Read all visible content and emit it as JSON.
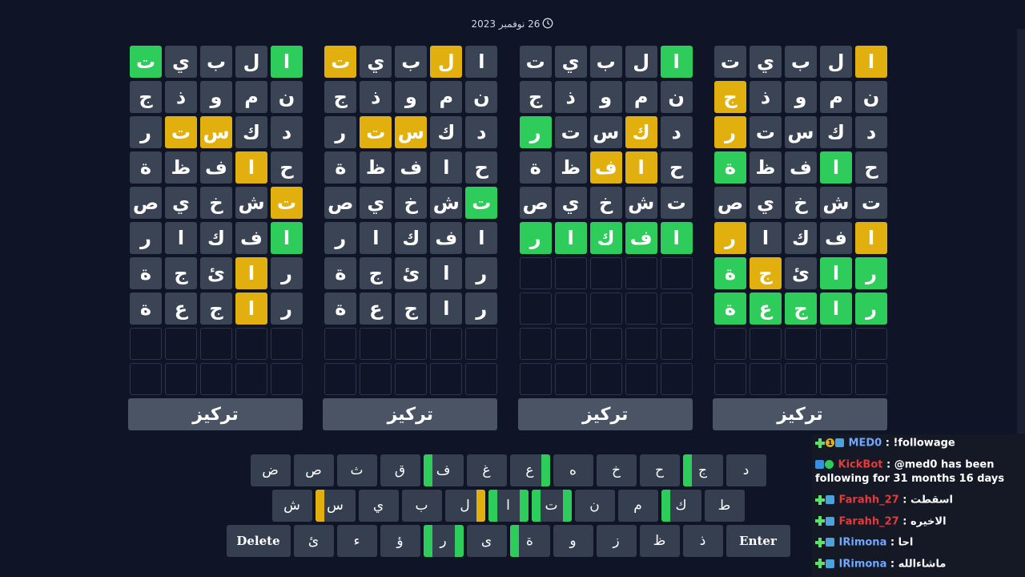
{
  "date": "26 نوفمبر 2023",
  "focus_label": "تركيز",
  "boards": [
    {
      "rows": [
        [
          [
            "ا",
            "p"
          ],
          [
            "ل",
            ""
          ],
          [
            "ب",
            ""
          ],
          [
            "ي",
            ""
          ],
          [
            "ت",
            ""
          ]
        ],
        [
          [
            "ن",
            ""
          ],
          [
            "م",
            ""
          ],
          [
            "و",
            ""
          ],
          [
            "ذ",
            ""
          ],
          [
            "ج",
            "p"
          ]
        ],
        [
          [
            "د",
            ""
          ],
          [
            "ك",
            ""
          ],
          [
            "س",
            ""
          ],
          [
            "ت",
            ""
          ],
          [
            "ر",
            "p"
          ]
        ],
        [
          [
            "ح",
            ""
          ],
          [
            "ا",
            "c"
          ],
          [
            "ف",
            ""
          ],
          [
            "ظ",
            ""
          ],
          [
            "ة",
            "c"
          ]
        ],
        [
          [
            "ت",
            ""
          ],
          [
            "ش",
            ""
          ],
          [
            "خ",
            ""
          ],
          [
            "ي",
            ""
          ],
          [
            "ص",
            ""
          ]
        ],
        [
          [
            "ا",
            "p"
          ],
          [
            "ف",
            ""
          ],
          [
            "ك",
            ""
          ],
          [
            "ا",
            ""
          ],
          [
            "ر",
            "p"
          ]
        ],
        [
          [
            "ر",
            "c"
          ],
          [
            "ا",
            "c"
          ],
          [
            "ئ",
            ""
          ],
          [
            "ج",
            "p"
          ],
          [
            "ة",
            "c"
          ]
        ],
        [
          [
            "ر",
            "c"
          ],
          [
            "ا",
            "c"
          ],
          [
            "ج",
            "c"
          ],
          [
            "ع",
            "c"
          ],
          [
            "ة",
            "c"
          ]
        ],
        [
          [
            "",
            "e"
          ],
          [
            "",
            "e"
          ],
          [
            "",
            "e"
          ],
          [
            "",
            "e"
          ],
          [
            "",
            "e"
          ]
        ],
        [
          [
            "",
            "e"
          ],
          [
            "",
            "e"
          ],
          [
            "",
            "e"
          ],
          [
            "",
            "e"
          ],
          [
            "",
            "e"
          ]
        ]
      ]
    },
    {
      "rows": [
        [
          [
            "ا",
            "c"
          ],
          [
            "ل",
            ""
          ],
          [
            "ب",
            ""
          ],
          [
            "ي",
            ""
          ],
          [
            "ت",
            ""
          ]
        ],
        [
          [
            "ن",
            ""
          ],
          [
            "م",
            ""
          ],
          [
            "و",
            ""
          ],
          [
            "ذ",
            ""
          ],
          [
            "ج",
            ""
          ]
        ],
        [
          [
            "د",
            ""
          ],
          [
            "ك",
            "p"
          ],
          [
            "س",
            ""
          ],
          [
            "ت",
            ""
          ],
          [
            "ر",
            "c"
          ]
        ],
        [
          [
            "ح",
            ""
          ],
          [
            "ا",
            "p"
          ],
          [
            "ف",
            "p"
          ],
          [
            "ظ",
            ""
          ],
          [
            "ة",
            ""
          ]
        ],
        [
          [
            "ت",
            ""
          ],
          [
            "ش",
            ""
          ],
          [
            "خ",
            ""
          ],
          [
            "ي",
            ""
          ],
          [
            "ص",
            ""
          ]
        ],
        [
          [
            "ا",
            "c"
          ],
          [
            "ف",
            "c"
          ],
          [
            "ك",
            "c"
          ],
          [
            "ا",
            "c"
          ],
          [
            "ر",
            "c"
          ]
        ],
        [
          [
            "",
            "e"
          ],
          [
            "",
            "e"
          ],
          [
            "",
            "e"
          ],
          [
            "",
            "e"
          ],
          [
            "",
            "e"
          ]
        ],
        [
          [
            "",
            "e"
          ],
          [
            "",
            "e"
          ],
          [
            "",
            "e"
          ],
          [
            "",
            "e"
          ],
          [
            "",
            "e"
          ]
        ],
        [
          [
            "",
            "e"
          ],
          [
            "",
            "e"
          ],
          [
            "",
            "e"
          ],
          [
            "",
            "e"
          ],
          [
            "",
            "e"
          ]
        ],
        [
          [
            "",
            "e"
          ],
          [
            "",
            "e"
          ],
          [
            "",
            "e"
          ],
          [
            "",
            "e"
          ],
          [
            "",
            "e"
          ]
        ]
      ]
    },
    {
      "rows": [
        [
          [
            "ا",
            ""
          ],
          [
            "ل",
            "p"
          ],
          [
            "ب",
            ""
          ],
          [
            "ي",
            ""
          ],
          [
            "ت",
            "p"
          ]
        ],
        [
          [
            "ن",
            ""
          ],
          [
            "م",
            ""
          ],
          [
            "و",
            ""
          ],
          [
            "ذ",
            ""
          ],
          [
            "ج",
            ""
          ]
        ],
        [
          [
            "د",
            ""
          ],
          [
            "ك",
            ""
          ],
          [
            "س",
            "p"
          ],
          [
            "ت",
            "p"
          ],
          [
            "ر",
            ""
          ]
        ],
        [
          [
            "ح",
            ""
          ],
          [
            "ا",
            ""
          ],
          [
            "ف",
            ""
          ],
          [
            "ظ",
            ""
          ],
          [
            "ة",
            ""
          ]
        ],
        [
          [
            "ت",
            "c"
          ],
          [
            "ش",
            ""
          ],
          [
            "خ",
            ""
          ],
          [
            "ي",
            ""
          ],
          [
            "ص",
            ""
          ]
        ],
        [
          [
            "ا",
            ""
          ],
          [
            "ف",
            ""
          ],
          [
            "ك",
            ""
          ],
          [
            "ا",
            ""
          ],
          [
            "ر",
            ""
          ]
        ],
        [
          [
            "ر",
            ""
          ],
          [
            "ا",
            ""
          ],
          [
            "ئ",
            ""
          ],
          [
            "ج",
            ""
          ],
          [
            "ة",
            ""
          ]
        ],
        [
          [
            "ر",
            ""
          ],
          [
            "ا",
            ""
          ],
          [
            "ج",
            ""
          ],
          [
            "ع",
            ""
          ],
          [
            "ة",
            ""
          ]
        ],
        [
          [
            "",
            "e"
          ],
          [
            "",
            "e"
          ],
          [
            "",
            "e"
          ],
          [
            "",
            "e"
          ],
          [
            "",
            "e"
          ]
        ],
        [
          [
            "",
            "e"
          ],
          [
            "",
            "e"
          ],
          [
            "",
            "e"
          ],
          [
            "",
            "e"
          ],
          [
            "",
            "e"
          ]
        ]
      ]
    },
    {
      "rows": [
        [
          [
            "ا",
            "c"
          ],
          [
            "ل",
            ""
          ],
          [
            "ب",
            ""
          ],
          [
            "ي",
            ""
          ],
          [
            "ت",
            "c"
          ]
        ],
        [
          [
            "ن",
            ""
          ],
          [
            "م",
            ""
          ],
          [
            "و",
            ""
          ],
          [
            "ذ",
            ""
          ],
          [
            "ج",
            ""
          ]
        ],
        [
          [
            "د",
            ""
          ],
          [
            "ك",
            ""
          ],
          [
            "س",
            "p"
          ],
          [
            "ت",
            "p"
          ],
          [
            "ر",
            ""
          ]
        ],
        [
          [
            "ح",
            ""
          ],
          [
            "ا",
            "p"
          ],
          [
            "ف",
            ""
          ],
          [
            "ظ",
            ""
          ],
          [
            "ة",
            ""
          ]
        ],
        [
          [
            "ت",
            "p"
          ],
          [
            "ش",
            ""
          ],
          [
            "خ",
            ""
          ],
          [
            "ي",
            ""
          ],
          [
            "ص",
            ""
          ]
        ],
        [
          [
            "ا",
            "c"
          ],
          [
            "ف",
            ""
          ],
          [
            "ك",
            ""
          ],
          [
            "ا",
            ""
          ],
          [
            "ر",
            ""
          ]
        ],
        [
          [
            "ر",
            ""
          ],
          [
            "ا",
            "p"
          ],
          [
            "ئ",
            ""
          ],
          [
            "ج",
            ""
          ],
          [
            "ة",
            ""
          ]
        ],
        [
          [
            "ر",
            ""
          ],
          [
            "ا",
            "p"
          ],
          [
            "ج",
            ""
          ],
          [
            "ع",
            ""
          ],
          [
            "ة",
            ""
          ]
        ],
        [
          [
            "",
            "e"
          ],
          [
            "",
            "e"
          ],
          [
            "",
            "e"
          ],
          [
            "",
            "e"
          ],
          [
            "",
            "e"
          ]
        ],
        [
          [
            "",
            "e"
          ],
          [
            "",
            "e"
          ],
          [
            "",
            "e"
          ],
          [
            "",
            "e"
          ],
          [
            "",
            "e"
          ]
        ]
      ]
    }
  ],
  "keyboard": {
    "rows": [
      [
        [
          "د",
          "--"
        ],
        [
          "ج",
          "c-"
        ],
        [
          "ح",
          "--"
        ],
        [
          "خ",
          "--"
        ],
        [
          "ه",
          "--"
        ],
        [
          "ع",
          "-c"
        ],
        [
          "غ",
          "--"
        ],
        [
          "ف",
          "c-"
        ],
        [
          "ق",
          "--"
        ],
        [
          "ث",
          "--"
        ],
        [
          "ص",
          "--"
        ],
        [
          "ض",
          "--"
        ]
      ],
      [
        [
          "ط",
          "--"
        ],
        [
          "ك",
          "c-"
        ],
        [
          "م",
          "--"
        ],
        [
          "ن",
          "--"
        ],
        [
          "ت",
          "cc"
        ],
        [
          "ا",
          "cc"
        ],
        [
          "ل",
          "-p"
        ],
        [
          "ب",
          "--"
        ],
        [
          "ي",
          "--"
        ],
        [
          "س",
          "p-"
        ],
        [
          "ش",
          "--"
        ]
      ],
      [
        [
          "Enter",
          "--"
        ],
        [
          "ذ",
          "--"
        ],
        [
          "ظ",
          "--"
        ],
        [
          "ز",
          "--"
        ],
        [
          "و",
          "--"
        ],
        [
          "ة",
          "c-"
        ],
        [
          "ى",
          "--"
        ],
        [
          "ر",
          "cc"
        ],
        [
          "ؤ",
          "--"
        ],
        [
          "ء",
          "--"
        ],
        [
          "ئ",
          "--"
        ],
        [
          "Delete",
          "--"
        ]
      ]
    ]
  },
  "chat": [
    {
      "badges": [
        "plus",
        "sub",
        "gg"
      ],
      "user": "MED0",
      "user_color": "#6ea8ff",
      "text": "!followage"
    },
    {
      "badges": [
        "mod",
        "ok"
      ],
      "user": "KickBot",
      "user_color": "#e23b3b",
      "text": "@med0 has been following for 31 months 16 days"
    },
    {
      "badges": [
        "plus",
        "gg"
      ],
      "user": "Farahh_27",
      "user_color": "#e23b3b",
      "text": "اسقطت"
    },
    {
      "badges": [
        "plus",
        "gg"
      ],
      "user": "Farahh_27",
      "user_color": "#e23b3b",
      "text": "الاخيره"
    },
    {
      "badges": [
        "plus",
        "gg"
      ],
      "user": "IRimona",
      "user_color": "#6ea8ff",
      "text": "احا"
    },
    {
      "badges": [
        "plus",
        "gg"
      ],
      "user": "IRimona",
      "user_color": "#6ea8ff",
      "text": "ماشاءالله"
    }
  ],
  "colors": {
    "correct": "#2ecc5a",
    "present": "#e2b00e",
    "tile": "#3a4454",
    "bg": "#0f1426"
  }
}
